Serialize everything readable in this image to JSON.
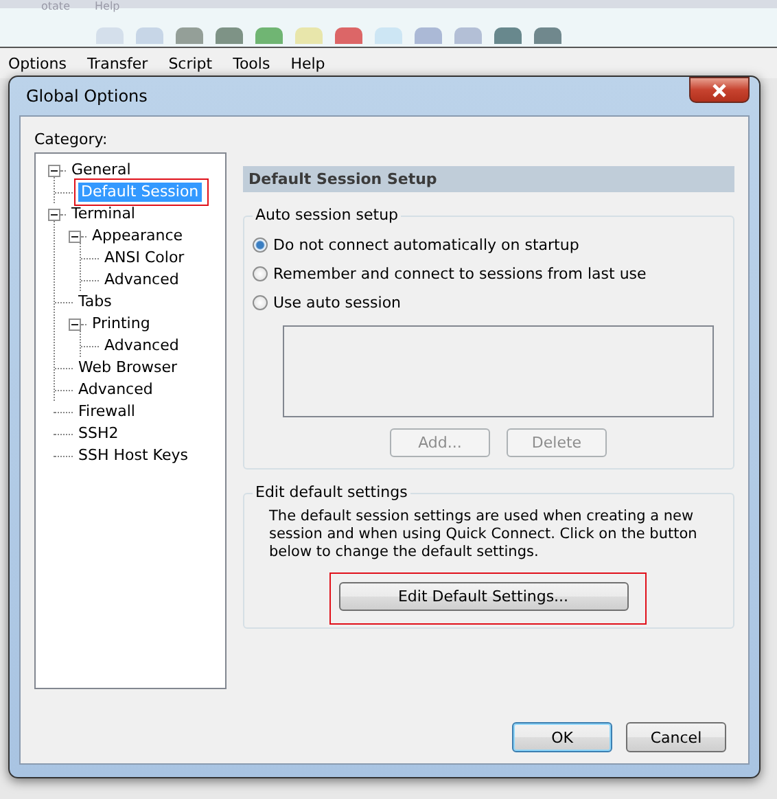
{
  "background_app": {
    "menu_top": [
      "otate",
      "Help"
    ],
    "menu": [
      "Options",
      "Transfer",
      "Script",
      "Tools",
      "Help"
    ]
  },
  "dialog": {
    "title": "Global Options",
    "category_label": "Category:",
    "tree": [
      {
        "label": "General",
        "expanded": true,
        "selected": false,
        "children": [
          {
            "label": "Default Session",
            "selected": true,
            "highlighted": true
          }
        ]
      },
      {
        "label": "Terminal",
        "expanded": true,
        "selected": false,
        "children": [
          {
            "label": "Appearance",
            "expanded": true,
            "selected": false,
            "children": [
              {
                "label": "ANSI Color",
                "selected": false
              },
              {
                "label": "Advanced",
                "selected": false
              }
            ]
          },
          {
            "label": "Tabs",
            "selected": false
          },
          {
            "label": "Printing",
            "expanded": true,
            "selected": false,
            "children": [
              {
                "label": "Advanced",
                "selected": false
              }
            ]
          },
          {
            "label": "Web Browser",
            "selected": false
          },
          {
            "label": "Advanced",
            "selected": false
          }
        ]
      },
      {
        "label": "Firewall",
        "selected": false
      },
      {
        "label": "SSH2",
        "selected": false
      },
      {
        "label": "SSH Host Keys",
        "selected": false
      }
    ],
    "header": "Default Session Setup",
    "auto_group": {
      "title": "Auto session setup",
      "options": [
        {
          "label": "Do not connect automatically on startup",
          "selected": true
        },
        {
          "label": "Remember and connect to sessions from last use",
          "selected": false
        },
        {
          "label": "Use auto session",
          "selected": false
        }
      ],
      "buttons": [
        {
          "label": "Add...",
          "disabled": true
        },
        {
          "label": "Delete",
          "disabled": true
        }
      ]
    },
    "edit_group": {
      "title": "Edit default settings",
      "description": "The default session settings are used when creating a new session and when using Quick Connect.  Click on the button below to change the default settings.",
      "button": {
        "label": "Edit Default Settings...",
        "highlighted": true
      }
    },
    "buttons": [
      {
        "label": "OK",
        "default": true
      },
      {
        "label": "Cancel",
        "default": false
      }
    ]
  }
}
